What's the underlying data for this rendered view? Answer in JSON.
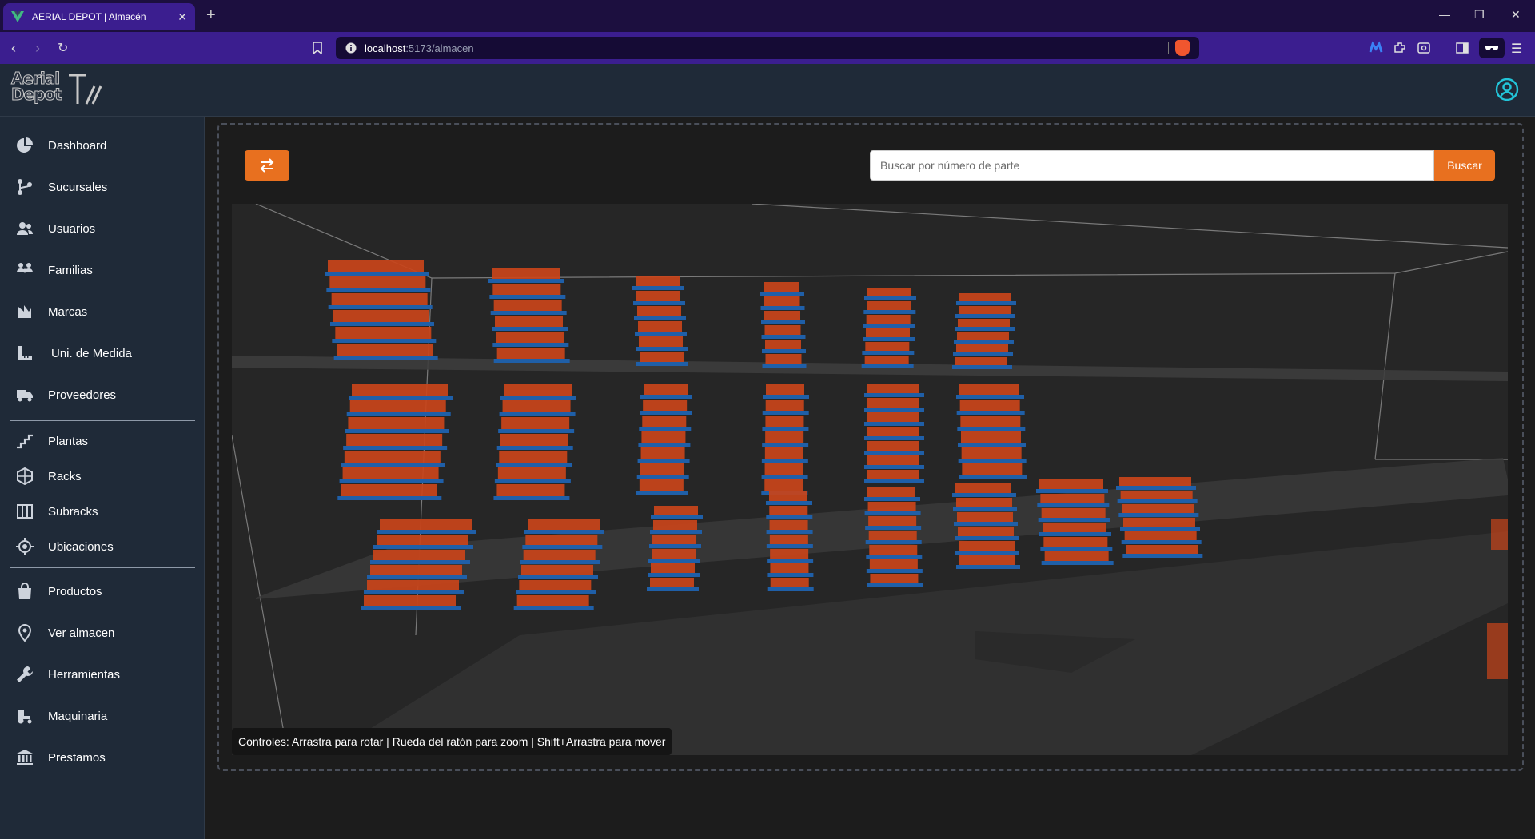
{
  "browser": {
    "tab_title": "AERIAL DEPOT | Almacén",
    "url_host": "localhost",
    "url_path": ":5173/almacen"
  },
  "header": {
    "logo_line1": "Aerial",
    "logo_line2": "Depot"
  },
  "sidebar": {
    "items": [
      {
        "label": "Dashboard",
        "icon": "pie-chart-icon"
      },
      {
        "label": "Sucursales",
        "icon": "branch-icon"
      },
      {
        "label": "Usuarios",
        "icon": "users-icon"
      },
      {
        "label": "Familias",
        "icon": "family-icon"
      },
      {
        "label": "Marcas",
        "icon": "brand-icon"
      },
      {
        "label": "Uni. de Medida",
        "icon": "ruler-icon"
      },
      {
        "label": "Proveedores",
        "icon": "truck-icon"
      },
      {
        "label": "Plantas",
        "icon": "stairs-icon"
      },
      {
        "label": "Racks",
        "icon": "rack-icon"
      },
      {
        "label": "Subracks",
        "icon": "columns-icon"
      },
      {
        "label": "Ubicaciones",
        "icon": "target-icon"
      },
      {
        "label": "Productos",
        "icon": "bag-icon"
      },
      {
        "label": "Ver almacen",
        "icon": "map-pin-icon"
      },
      {
        "label": "Herramientas",
        "icon": "wrench-icon"
      },
      {
        "label": "Maquinaria",
        "icon": "tractor-icon"
      },
      {
        "label": "Prestamos",
        "icon": "bank-icon"
      }
    ]
  },
  "main": {
    "search_placeholder": "Buscar por número de parte",
    "search_button": "Buscar",
    "controls_hint": "Controles: Arrastra para rotar | Rueda del ratón para zoom | Shift+Arrastra para mover"
  },
  "colors": {
    "accent": "#e8701f",
    "sidebar_bg": "#1f2a38",
    "browser_purple": "#3b1e8f",
    "box_orange": "#c9441a",
    "shelf_blue": "#1f5fa8"
  }
}
